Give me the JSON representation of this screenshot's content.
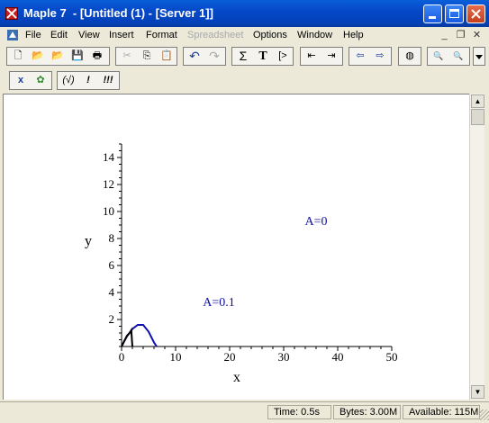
{
  "window": {
    "title": "Maple 7  - [Untitled (1) - [Server 1]]"
  },
  "menu": [
    "File",
    "Edit",
    "View",
    "Insert",
    "Format",
    "Spreadsheet",
    "Options",
    "Window",
    "Help"
  ],
  "menu_disabled": [
    "Spreadsheet"
  ],
  "toolbar_context": {
    "x_label": "x",
    "check": "(√)",
    "exec1": "!",
    "exec3": "!!!"
  },
  "toolbar_main": {
    "sigma": "Σ",
    "text": "T",
    "prompt": "[>"
  },
  "status": {
    "time": "Time:   0.5s",
    "bytes": "Bytes: 3.00M",
    "available": "Available: 115M"
  },
  "chart_data": {
    "type": "line",
    "xlabel": "x",
    "ylabel": "y",
    "xlim": [
      0,
      50
    ],
    "ylim": [
      0,
      15
    ],
    "x_ticks": [
      0,
      10,
      20,
      30,
      40,
      50
    ],
    "y_ticks": [
      2,
      4,
      6,
      8,
      10,
      12,
      14
    ],
    "annotations": [
      {
        "text": "A=0",
        "x": 36,
        "y": 9,
        "color": "#1010a0"
      },
      {
        "text": "A=0.1",
        "x": 18,
        "y": 3,
        "color": "#1010a0"
      }
    ],
    "series": [
      {
        "color": "#1010b0",
        "x": [
          0,
          0.5,
          1,
          2,
          3,
          4,
          5,
          6,
          6.5
        ],
        "y": [
          0,
          0.4,
          0.75,
          1.3,
          1.6,
          1.6,
          1.1,
          0.3,
          0
        ]
      },
      {
        "color": "#000000",
        "x": [
          0,
          0.5,
          1,
          1.5,
          1.8,
          2
        ],
        "y": [
          0,
          0.4,
          0.8,
          1.0,
          1.2,
          0
        ]
      }
    ]
  }
}
